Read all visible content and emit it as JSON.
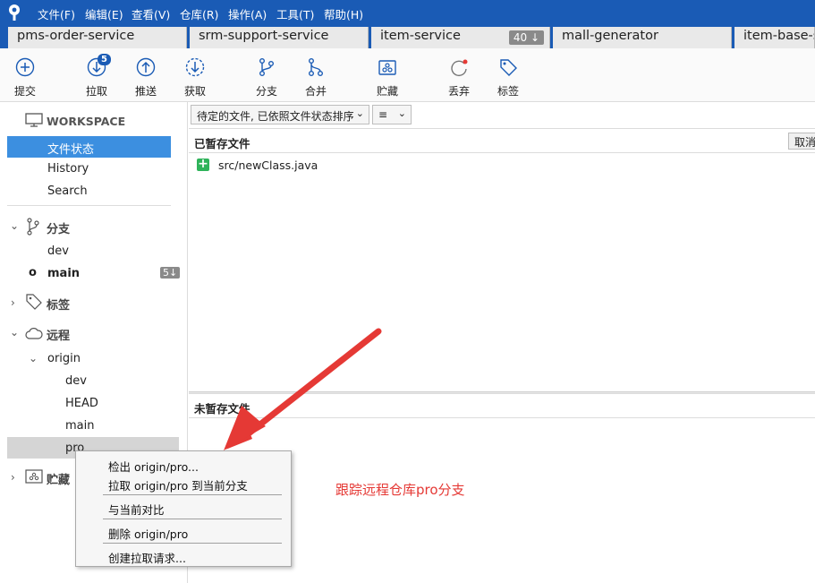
{
  "menubar": {
    "items": [
      "文件(F)",
      "编辑(E)",
      "查看(V)",
      "仓库(R)",
      "操作(A)",
      "工具(T)",
      "帮助(H)"
    ]
  },
  "tabs": [
    {
      "label": "pms-order-service"
    },
    {
      "label": "srm-support-service"
    },
    {
      "label": "item-service",
      "badge": "40 ↓"
    },
    {
      "label": "mall-generator"
    },
    {
      "label": "item-base-s"
    }
  ],
  "toolbar": {
    "commit": "提交",
    "pull": "拉取",
    "pull_badge": "5",
    "push": "推送",
    "fetch": "获取",
    "branch": "分支",
    "merge": "合并",
    "stash": "贮藏",
    "discard": "丢弃",
    "tag": "标签"
  },
  "sidebar": {
    "workspace": "WORKSPACE",
    "file_status": "文件状态",
    "history": "History",
    "search": "Search",
    "branches": "分支",
    "branch_dev": "dev",
    "branch_main": "main",
    "branch_main_badge": "5↓",
    "tags": "标签",
    "remotes": "远程",
    "remote_origin": "origin",
    "remote_dev": "dev",
    "remote_head": "HEAD",
    "remote_main": "main",
    "remote_pro": "pro",
    "stashes": "贮藏"
  },
  "main": {
    "sort_dropdown": "待定的文件, 已依照文件状态排序",
    "view_dropdown": "≡",
    "staged_title": "已暂存文件",
    "cancel_label": "取消",
    "staged_file": "src/newClass.java",
    "unstaged_title": "未暂存文件"
  },
  "context_menu": {
    "items": [
      "检出 origin/pro...",
      "拉取 origin/pro 到当前分支",
      "与当前对比",
      "删除 origin/pro",
      "创建拉取请求..."
    ]
  },
  "annotation": {
    "text": "跟踪远程仓库pro分支"
  },
  "colors": {
    "accent": "#1a5bb5",
    "selection": "#3c8fe0",
    "added": "#2fb35a",
    "annotation": "#e53935"
  }
}
